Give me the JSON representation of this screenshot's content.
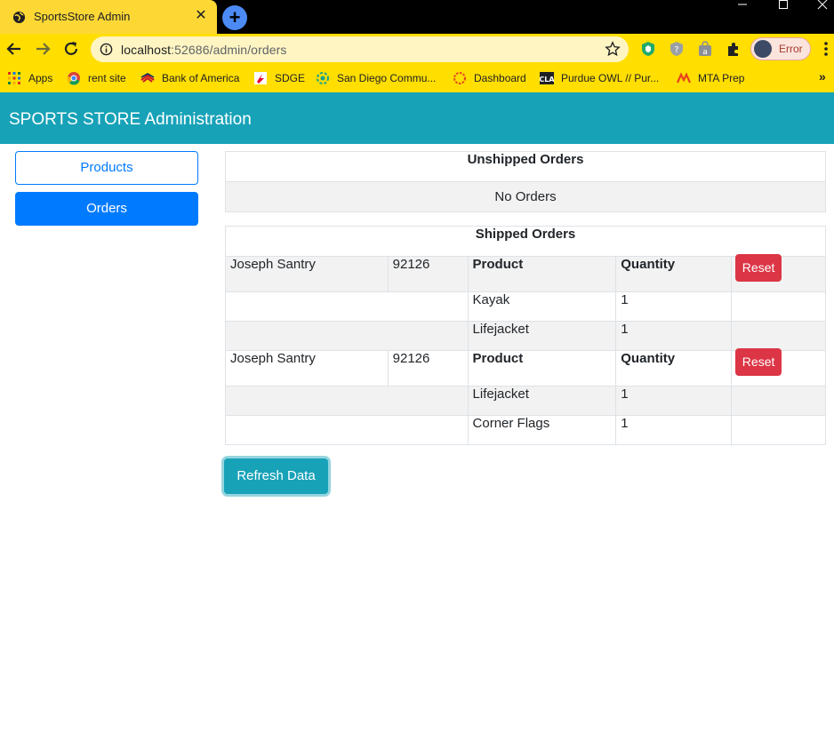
{
  "browser": {
    "tab_title": "SportsStore Admin",
    "url_host": "localhost",
    "url_path": ":52686/admin/orders",
    "profile_label": "Error",
    "bookmarks": [
      {
        "label": "Apps",
        "icon": "apps-grid-icon"
      },
      {
        "label": "rent site",
        "icon": "chrome-icon"
      },
      {
        "label": "Bank of America",
        "icon": "bank-of-america-icon"
      },
      {
        "label": "SDGE",
        "icon": "sdge-icon"
      },
      {
        "label": "San Diego Commu...",
        "icon": "community-icon"
      },
      {
        "label": "Dashboard",
        "icon": "dashboard-icon"
      },
      {
        "label": "Purdue OWL // Pur...",
        "icon": "cla-icon"
      },
      {
        "label": "MTA Prep",
        "icon": "mta-icon"
      }
    ],
    "more_bookmarks": "»"
  },
  "app": {
    "title": "SPORTS STORE Administration"
  },
  "sidebar": {
    "products_label": "Products",
    "orders_label": "Orders"
  },
  "unshipped": {
    "title": "Unshipped Orders",
    "empty_text": "No Orders"
  },
  "shipped": {
    "title": "Shipped Orders",
    "product_header": "Product",
    "quantity_header": "Quantity",
    "reset_label": "Reset",
    "orders": [
      {
        "name": "Joseph Santry",
        "zip": "92126",
        "lines": [
          {
            "product": "Kayak",
            "quantity": "1"
          },
          {
            "product": "Lifejacket",
            "quantity": "1"
          }
        ]
      },
      {
        "name": "Joseph Santry",
        "zip": "92126",
        "lines": [
          {
            "product": "Lifejacket",
            "quantity": "1"
          },
          {
            "product": "Corner Flags",
            "quantity": "1"
          }
        ]
      }
    ]
  },
  "actions": {
    "refresh_label": "Refresh Data"
  },
  "colors": {
    "chrome_yellow": "#ffde00",
    "header_teal": "#17a2b8",
    "primary_blue": "#007bff",
    "danger_red": "#dc3545"
  }
}
